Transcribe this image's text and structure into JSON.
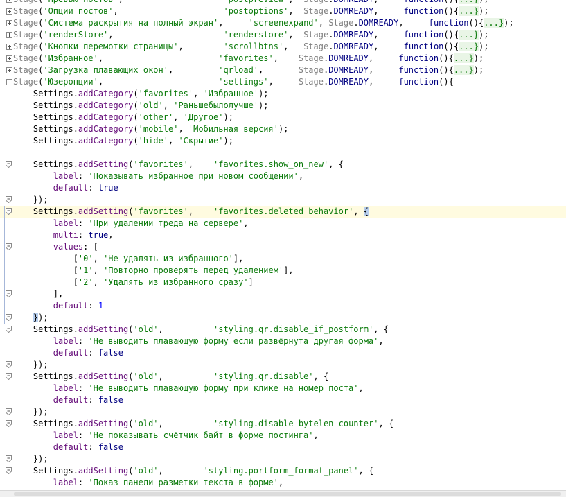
{
  "lines": [
    {
      "fold": "plus",
      "segs": [
        [
          "stage",
          "Stage"
        ],
        [
          "p",
          "("
        ],
        [
          "str",
          "'Превью постов'"
        ],
        [
          "p",
          ",                    "
        ],
        [
          "str",
          "'postpreview'"
        ],
        [
          "p",
          ",  "
        ],
        [
          "stage",
          "Stage"
        ],
        [
          "p",
          "."
        ],
        [
          "kw",
          "DOMREADY"
        ],
        [
          "p",
          ",     "
        ],
        [
          "kw",
          "function"
        ],
        [
          "p",
          "(){"
        ],
        [
          "fold",
          "...}"
        ],
        [
          "p",
          ");"
        ]
      ]
    },
    {
      "fold": "plus",
      "segs": [
        [
          "stage",
          "Stage"
        ],
        [
          "p",
          "("
        ],
        [
          "str",
          "'Опции постов'"
        ],
        [
          "p",
          ",                     "
        ],
        [
          "str",
          "'postoptions'"
        ],
        [
          "p",
          ",  "
        ],
        [
          "stage",
          "Stage"
        ],
        [
          "p",
          "."
        ],
        [
          "kw",
          "DOMREADY"
        ],
        [
          "p",
          ",     "
        ],
        [
          "kw",
          "function"
        ],
        [
          "p",
          "(){"
        ],
        [
          "fold",
          "...}"
        ],
        [
          "p",
          ");"
        ]
      ]
    },
    {
      "fold": "plus",
      "segs": [
        [
          "stage",
          "Stage"
        ],
        [
          "p",
          "("
        ],
        [
          "str",
          "'Система раскрытия на полный экран'"
        ],
        [
          "p",
          ",     "
        ],
        [
          "str",
          "'screenexpand'"
        ],
        [
          "p",
          ", "
        ],
        [
          "stage",
          "Stage"
        ],
        [
          "p",
          "."
        ],
        [
          "kw",
          "DOMREADY"
        ],
        [
          "p",
          ",     "
        ],
        [
          "kw",
          "function"
        ],
        [
          "p",
          "(){"
        ],
        [
          "fold",
          "...}"
        ],
        [
          "p",
          ");"
        ]
      ]
    },
    {
      "fold": "plus",
      "segs": [
        [
          "stage",
          "Stage"
        ],
        [
          "p",
          "("
        ],
        [
          "str",
          "'renderStore'"
        ],
        [
          "p",
          ",                      "
        ],
        [
          "str",
          "'renderstore'"
        ],
        [
          "p",
          ",  "
        ],
        [
          "stage",
          "Stage"
        ],
        [
          "p",
          "."
        ],
        [
          "kw",
          "DOMREADY"
        ],
        [
          "p",
          ",     "
        ],
        [
          "kw",
          "function"
        ],
        [
          "p",
          "(){"
        ],
        [
          "fold",
          "...}"
        ],
        [
          "p",
          ");"
        ]
      ]
    },
    {
      "fold": "plus",
      "segs": [
        [
          "stage",
          "Stage"
        ],
        [
          "p",
          "("
        ],
        [
          "str",
          "'Кнопки перемотки страницы'"
        ],
        [
          "p",
          ",        "
        ],
        [
          "str",
          "'scrollbtns'"
        ],
        [
          "p",
          ",   "
        ],
        [
          "stage",
          "Stage"
        ],
        [
          "p",
          "."
        ],
        [
          "kw",
          "DOMREADY"
        ],
        [
          "p",
          ",     "
        ],
        [
          "kw",
          "function"
        ],
        [
          "p",
          "(){"
        ],
        [
          "fold",
          "...}"
        ],
        [
          "p",
          ");"
        ]
      ]
    },
    {
      "fold": "plus",
      "segs": [
        [
          "stage",
          "Stage"
        ],
        [
          "p",
          "("
        ],
        [
          "str",
          "'Избранное'"
        ],
        [
          "p",
          ",                       "
        ],
        [
          "str",
          "'favorites'"
        ],
        [
          "p",
          ",    "
        ],
        [
          "stage",
          "Stage"
        ],
        [
          "p",
          "."
        ],
        [
          "kw",
          "DOMREADY"
        ],
        [
          "p",
          ",     "
        ],
        [
          "kw",
          "function"
        ],
        [
          "p",
          "(){"
        ],
        [
          "fold",
          "...}"
        ],
        [
          "p",
          ");"
        ]
      ]
    },
    {
      "fold": "plus",
      "segs": [
        [
          "stage",
          "Stage"
        ],
        [
          "p",
          "("
        ],
        [
          "str",
          "'Загрузка плавающих окон'"
        ],
        [
          "p",
          ",         "
        ],
        [
          "str",
          "'qrload'"
        ],
        [
          "p",
          ",       "
        ],
        [
          "stage",
          "Stage"
        ],
        [
          "p",
          "."
        ],
        [
          "kw",
          "DOMREADY"
        ],
        [
          "p",
          ",     "
        ],
        [
          "kw",
          "function"
        ],
        [
          "p",
          "(){"
        ],
        [
          "fold",
          "...}"
        ],
        [
          "p",
          ");"
        ]
      ]
    },
    {
      "fold": "minus",
      "segs": [
        [
          "stage",
          "Stage"
        ],
        [
          "p",
          "("
        ],
        [
          "str",
          "'Юзеропции'"
        ],
        [
          "p",
          ",                       "
        ],
        [
          "str",
          "'settings'"
        ],
        [
          "p",
          ",     "
        ],
        [
          "stage",
          "Stage"
        ],
        [
          "p",
          "."
        ],
        [
          "kw",
          "DOMREADY"
        ],
        [
          "p",
          ",     "
        ],
        [
          "kw",
          "function"
        ],
        [
          "p",
          "(){"
        ]
      ]
    },
    {
      "segs": [
        [
          "p",
          "    Settings."
        ],
        [
          "prop",
          "addCategory"
        ],
        [
          "p",
          "("
        ],
        [
          "str",
          "'favorites'"
        ],
        [
          "p",
          ", "
        ],
        [
          "str",
          "'Избранное'"
        ],
        [
          "p",
          ");"
        ]
      ]
    },
    {
      "segs": [
        [
          "p",
          "    Settings."
        ],
        [
          "prop",
          "addCategory"
        ],
        [
          "p",
          "("
        ],
        [
          "str",
          "'old'"
        ],
        [
          "p",
          ", "
        ],
        [
          "str",
          "'Раньшебылолучше'"
        ],
        [
          "p",
          ");"
        ]
      ]
    },
    {
      "segs": [
        [
          "p",
          "    Settings."
        ],
        [
          "prop",
          "addCategory"
        ],
        [
          "p",
          "("
        ],
        [
          "str",
          "'other'"
        ],
        [
          "p",
          ", "
        ],
        [
          "str",
          "'Другое'"
        ],
        [
          "p",
          ");"
        ]
      ]
    },
    {
      "segs": [
        [
          "p",
          "    Settings."
        ],
        [
          "prop",
          "addCategory"
        ],
        [
          "p",
          "("
        ],
        [
          "str",
          "'mobile'"
        ],
        [
          "p",
          ", "
        ],
        [
          "str",
          "'Мобильная версия'"
        ],
        [
          "p",
          ");"
        ]
      ]
    },
    {
      "segs": [
        [
          "p",
          "    Settings."
        ],
        [
          "prop",
          "addCategory"
        ],
        [
          "p",
          "("
        ],
        [
          "str",
          "'hide'"
        ],
        [
          "p",
          ", "
        ],
        [
          "str",
          "'Скрытие'"
        ],
        [
          "p",
          ");"
        ]
      ]
    },
    {
      "segs": []
    },
    {
      "fold": "shield",
      "segs": [
        [
          "p",
          "    Settings."
        ],
        [
          "prop",
          "addSetting"
        ],
        [
          "p",
          "("
        ],
        [
          "str",
          "'favorites'"
        ],
        [
          "p",
          ",    "
        ],
        [
          "str",
          "'favorites.show_on_new'"
        ],
        [
          "p",
          ", {"
        ]
      ]
    },
    {
      "segs": [
        [
          "p",
          "        "
        ],
        [
          "prop",
          "label"
        ],
        [
          "p",
          ": "
        ],
        [
          "str",
          "'Показывать избранное при новом сообщении'"
        ],
        [
          "p",
          ","
        ]
      ]
    },
    {
      "segs": [
        [
          "p",
          "        "
        ],
        [
          "prop",
          "default"
        ],
        [
          "p",
          ": "
        ],
        [
          "kw",
          "true"
        ]
      ]
    },
    {
      "fold": "shield",
      "segs": [
        [
          "p",
          "    });"
        ]
      ]
    },
    {
      "fold": "shield",
      "caret": true,
      "scope": true,
      "segs": [
        [
          "p",
          "    Settings."
        ],
        [
          "prop",
          "addSetting"
        ],
        [
          "p",
          "("
        ],
        [
          "str",
          "'favorites'"
        ],
        [
          "p",
          ",    "
        ],
        [
          "str",
          "'favorites.deleted_behavior'"
        ],
        [
          "p",
          ", "
        ],
        [
          "hl",
          "{"
        ]
      ]
    },
    {
      "scope": true,
      "segs": [
        [
          "p",
          "        "
        ],
        [
          "prop",
          "label"
        ],
        [
          "p",
          ": "
        ],
        [
          "str",
          "'При удалении треда на сервере'"
        ],
        [
          "p",
          ","
        ]
      ]
    },
    {
      "scope": true,
      "segs": [
        [
          "p",
          "        "
        ],
        [
          "prop",
          "multi"
        ],
        [
          "p",
          ": "
        ],
        [
          "kw",
          "true"
        ],
        [
          "p",
          ","
        ]
      ]
    },
    {
      "fold": "shield",
      "scope": true,
      "segs": [
        [
          "p",
          "        "
        ],
        [
          "prop",
          "values"
        ],
        [
          "p",
          ": ["
        ]
      ]
    },
    {
      "scope": true,
      "segs": [
        [
          "p",
          "            ["
        ],
        [
          "str",
          "'0'"
        ],
        [
          "p",
          ", "
        ],
        [
          "str",
          "'Не удалять из избранного'"
        ],
        [
          "p",
          "],"
        ]
      ]
    },
    {
      "scope": true,
      "segs": [
        [
          "p",
          "            ["
        ],
        [
          "str",
          "'1'"
        ],
        [
          "p",
          ", "
        ],
        [
          "str",
          "'Повторно проверять перед удалением'"
        ],
        [
          "p",
          "],"
        ]
      ]
    },
    {
      "scope": true,
      "segs": [
        [
          "p",
          "            ["
        ],
        [
          "str",
          "'2'"
        ],
        [
          "p",
          ", "
        ],
        [
          "str",
          "'Удалять из избранного сразу'"
        ],
        [
          "p",
          "]"
        ]
      ]
    },
    {
      "fold": "shield",
      "scope": true,
      "segs": [
        [
          "p",
          "        ],"
        ]
      ]
    },
    {
      "scope": true,
      "segs": [
        [
          "p",
          "        "
        ],
        [
          "prop",
          "default"
        ],
        [
          "p",
          ": "
        ],
        [
          "num",
          "1"
        ]
      ]
    },
    {
      "fold": "shield",
      "scope": true,
      "segs": [
        [
          "p",
          "    "
        ],
        [
          "hl",
          "}"
        ],
        [
          "p",
          ");"
        ]
      ]
    },
    {
      "fold": "shield",
      "segs": [
        [
          "p",
          "    Settings."
        ],
        [
          "prop",
          "addSetting"
        ],
        [
          "p",
          "("
        ],
        [
          "str",
          "'old'"
        ],
        [
          "p",
          ",          "
        ],
        [
          "str",
          "'styling.qr.disable_if_postform'"
        ],
        [
          "p",
          ", {"
        ]
      ]
    },
    {
      "segs": [
        [
          "p",
          "        "
        ],
        [
          "prop",
          "label"
        ],
        [
          "p",
          ": "
        ],
        [
          "str",
          "'Не выводить плавающую форму если развёрнута другая форма'"
        ],
        [
          "p",
          ","
        ]
      ]
    },
    {
      "segs": [
        [
          "p",
          "        "
        ],
        [
          "prop",
          "default"
        ],
        [
          "p",
          ": "
        ],
        [
          "kw",
          "false"
        ]
      ]
    },
    {
      "fold": "shield",
      "segs": [
        [
          "p",
          "    });"
        ]
      ]
    },
    {
      "fold": "shield",
      "segs": [
        [
          "p",
          "    Settings."
        ],
        [
          "prop",
          "addSetting"
        ],
        [
          "p",
          "("
        ],
        [
          "str",
          "'old'"
        ],
        [
          "p",
          ",          "
        ],
        [
          "str",
          "'styling.qr.disable'"
        ],
        [
          "p",
          ", {"
        ]
      ]
    },
    {
      "segs": [
        [
          "p",
          "        "
        ],
        [
          "prop",
          "label"
        ],
        [
          "p",
          ": "
        ],
        [
          "str",
          "'Не выводить плавающую форму при клике на номер поста'"
        ],
        [
          "p",
          ","
        ]
      ]
    },
    {
      "segs": [
        [
          "p",
          "        "
        ],
        [
          "prop",
          "default"
        ],
        [
          "p",
          ": "
        ],
        [
          "kw",
          "false"
        ]
      ]
    },
    {
      "fold": "shield",
      "segs": [
        [
          "p",
          "    });"
        ]
      ]
    },
    {
      "fold": "shield",
      "segs": [
        [
          "p",
          "    Settings."
        ],
        [
          "prop",
          "addSetting"
        ],
        [
          "p",
          "("
        ],
        [
          "str",
          "'old'"
        ],
        [
          "p",
          ",          "
        ],
        [
          "str",
          "'styling.disable_bytelen_counter'"
        ],
        [
          "p",
          ", {"
        ]
      ]
    },
    {
      "segs": [
        [
          "p",
          "        "
        ],
        [
          "prop",
          "label"
        ],
        [
          "p",
          ": "
        ],
        [
          "str",
          "'Не показывать счётчик байт в форме постинга'"
        ],
        [
          "p",
          ","
        ]
      ]
    },
    {
      "segs": [
        [
          "p",
          "        "
        ],
        [
          "prop",
          "default"
        ],
        [
          "p",
          ": "
        ],
        [
          "kw",
          "false"
        ]
      ]
    },
    {
      "fold": "shield",
      "segs": [
        [
          "p",
          "    });"
        ]
      ]
    },
    {
      "fold": "shield",
      "segs": [
        [
          "p",
          "    Settings."
        ],
        [
          "prop",
          "addSetting"
        ],
        [
          "p",
          "("
        ],
        [
          "str",
          "'old'"
        ],
        [
          "p",
          ",        "
        ],
        [
          "str",
          "'styling.portform_format_panel'"
        ],
        [
          "p",
          ", {"
        ]
      ]
    },
    {
      "segs": [
        [
          "p",
          "        "
        ],
        [
          "prop",
          "label"
        ],
        [
          "p",
          ": "
        ],
        [
          "str",
          "'Показ панели разметки текста в форме'"
        ],
        [
          "p",
          ","
        ]
      ]
    }
  ]
}
